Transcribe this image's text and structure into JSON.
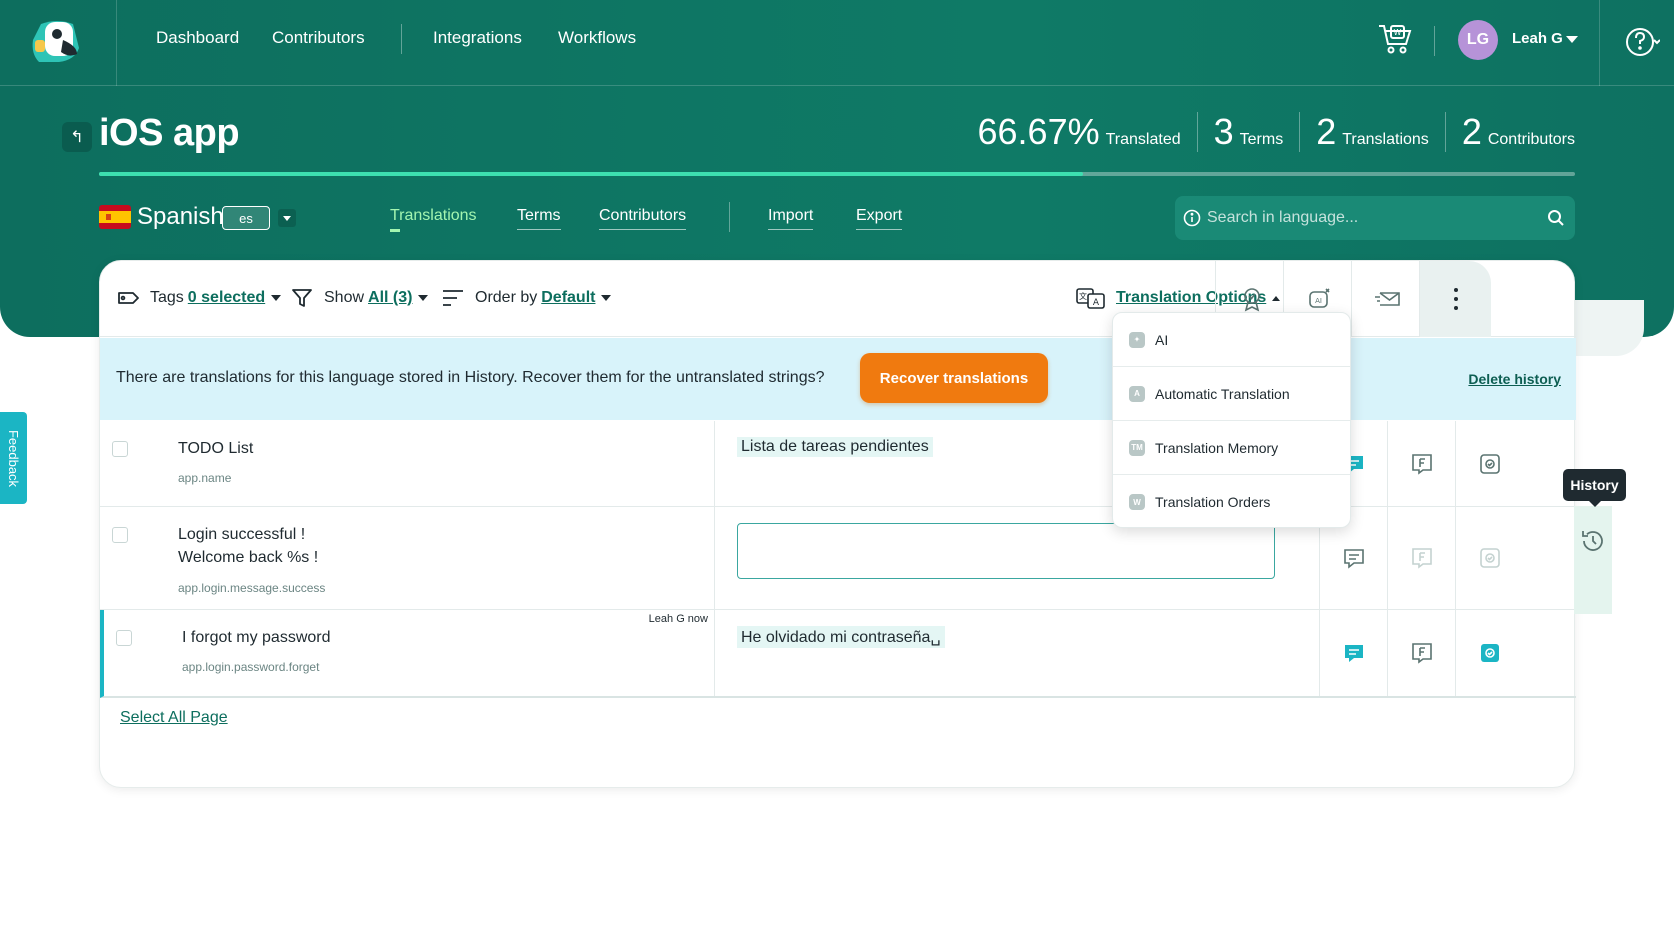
{
  "nav": {
    "links": [
      "Dashboard",
      "Contributors",
      "Integrations",
      "Workflows"
    ],
    "user_initials": "LG",
    "user_name": "Leah G"
  },
  "project": {
    "title": "iOS app",
    "stats": [
      {
        "num": "66.67%",
        "label": "Translated"
      },
      {
        "num": "3",
        "label": "Terms"
      },
      {
        "num": "2",
        "label": "Translations"
      },
      {
        "num": "2",
        "label": "Contributors"
      }
    ],
    "progress": 0.6667
  },
  "language": {
    "name": "Spanish",
    "code": "es",
    "tabs": [
      "Translations",
      "Terms",
      "Contributors",
      "Import",
      "Export"
    ],
    "active_tab": "Translations",
    "search_placeholder": "Search in language..."
  },
  "toolbar": {
    "tags_label": "Tags",
    "tags_value": "0 selected",
    "show_label": "Show",
    "show_value": "All (3)",
    "order_label": "Order by",
    "order_value": "Default",
    "translation_options": "Translation Options"
  },
  "banner": {
    "text": "There are translations for this language stored in History. Recover them for the untranslated strings?",
    "recover_button": "Recover translations",
    "delete_link": "Delete history"
  },
  "rows": [
    {
      "term": "TODO List",
      "key": "app.name",
      "translation": "Lista de tareas pendientes",
      "meta": ""
    },
    {
      "term_lines": [
        "Login successful !",
        "Welcome back %s !"
      ],
      "key": "app.login.message.success",
      "translation": "",
      "meta": ""
    },
    {
      "term": "I forgot my password",
      "key": "app.login.password.forget",
      "translation": "He olvidado mi contraseña␣",
      "meta": "Leah G now"
    }
  ],
  "dropdown": {
    "items": [
      {
        "label": "AI",
        "icon": "ai-icon"
      },
      {
        "label": "Automatic Translation",
        "icon": "automatic-translation-icon"
      },
      {
        "label": "Translation Memory",
        "icon": "translation-memory-icon"
      },
      {
        "label": "Translation Orders",
        "icon": "translation-orders-icon"
      }
    ]
  },
  "history_tooltip": "History",
  "select_all": "Select All Page",
  "feedback": "Feedback",
  "colors": {
    "header": "#0f7a66",
    "accent": "#0d6e5e",
    "orange": "#f07a0f",
    "cyan": "#1bb5c4",
    "banner": "#d8f3fa"
  }
}
